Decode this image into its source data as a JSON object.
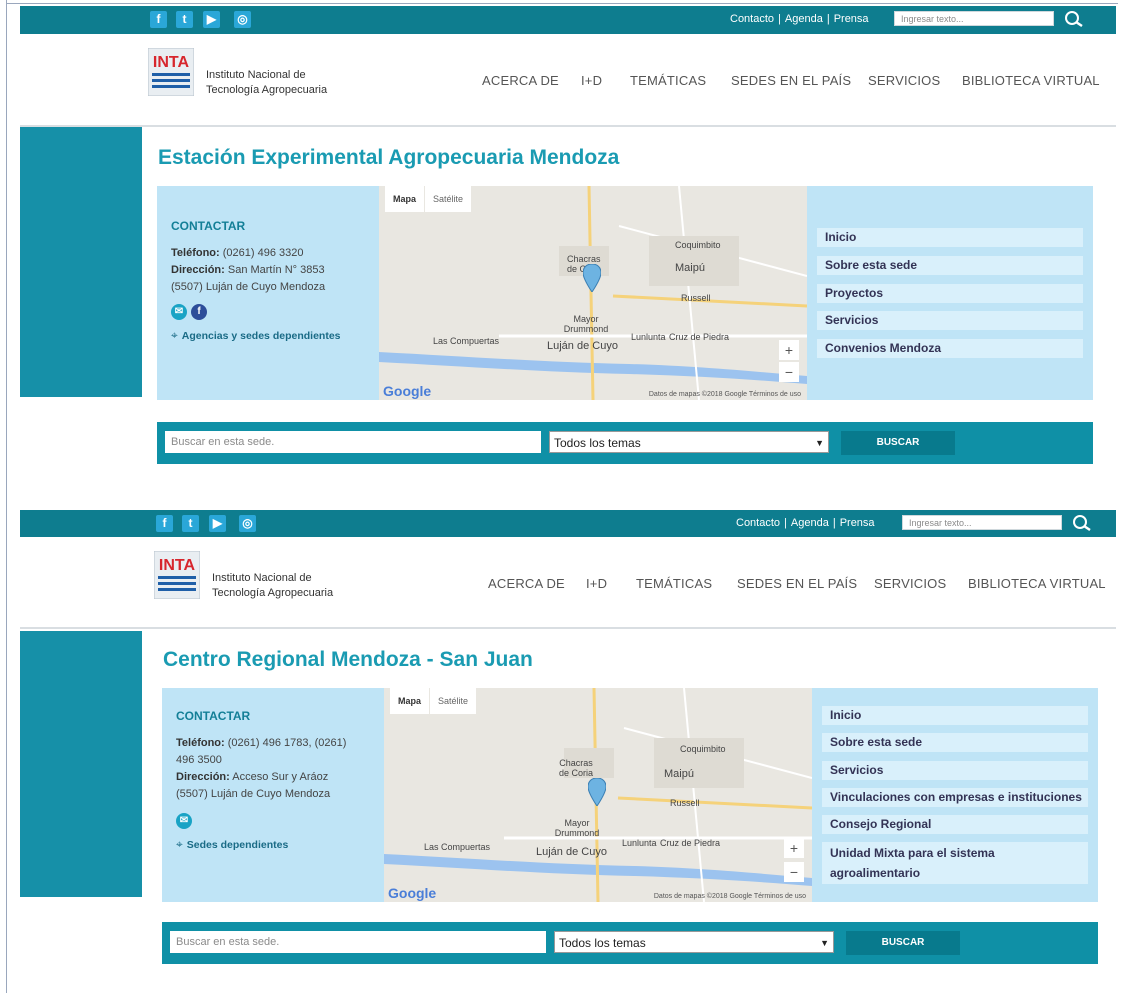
{
  "shared": {
    "social": [
      "f",
      "t",
      "▶",
      "◎"
    ],
    "top_links": [
      "Contacto",
      "Agenda",
      "Prensa"
    ],
    "top_search_placeholder": "Ingresar texto...",
    "logo_label": "INTA",
    "org_line1": "Instituto Nacional de",
    "org_line2": "Tecnología Agropecuaria",
    "nav": [
      "ACERCA DE",
      "I+D",
      "TEMÁTICAS",
      "SEDES EN EL PAÍS",
      "SERVICIOS",
      "BIBLIOTECA VIRTUAL"
    ],
    "contact_heading": "CONTACTAR",
    "map_tabs": [
      "Mapa",
      "Satélite"
    ],
    "map_places": [
      "Chacras de Coria",
      "Coquimbito",
      "Maipú",
      "Russell",
      "Mayor Drummond",
      "Lunlunta",
      "Cruz de Piedra",
      "Las Compuertas",
      "Luján de Cuyo"
    ],
    "map_footer": "Datos de mapas ©2018 Google   Términos de uso",
    "google": "Google",
    "search_placeholder": "Buscar en esta sede.",
    "select_value": "Todos los temas",
    "search_button": "BUSCAR",
    "brand_color": "#0e7d8f"
  },
  "page1": {
    "title": "Estación Experimental Agropecuaria Mendoza",
    "phone_label": "Teléfono:",
    "phone": "(0261) 496 3320",
    "address_label": "Dirección:",
    "address": "San Martín N° 3853",
    "address2": "(5507) Luján de Cuyo Mendoza",
    "dependents": "Agencias y sedes dependientes",
    "menu": [
      "Inicio",
      "Sobre esta sede",
      "Proyectos",
      "Servicios",
      "Convenios Mendoza"
    ]
  },
  "page2": {
    "title": "Centro Regional Mendoza - San Juan",
    "phone_label": "Teléfono:",
    "phone": "(0261) 496 1783, (0261) 496 3500",
    "address_label": "Dirección:",
    "address": "Acceso Sur y Aráoz",
    "address2": "(5507) Luján de Cuyo Mendoza",
    "dependents": "Sedes dependientes",
    "menu": [
      "Inicio",
      "Sobre esta sede",
      "Servicios",
      "Vinculaciones con empresas e instituciones",
      "Consejo Regional",
      "Unidad Mixta para el sistema agroalimentario"
    ]
  }
}
